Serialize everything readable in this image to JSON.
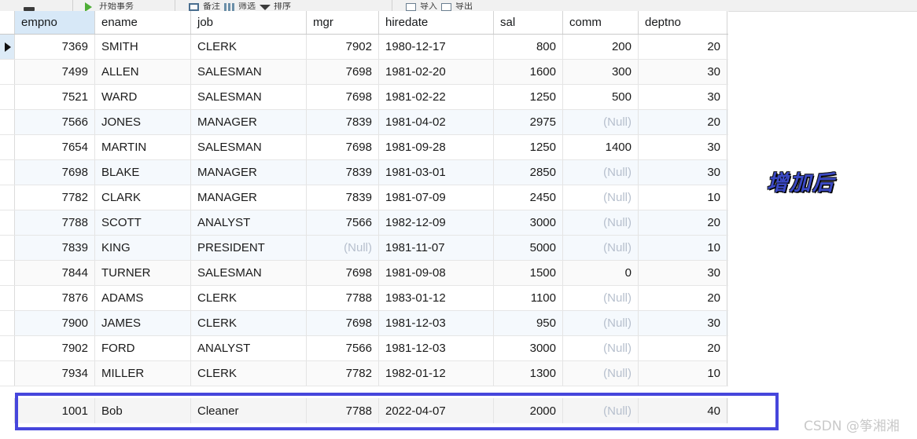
{
  "toolbar": {
    "groups": [
      {
        "items": [
          {
            "icon": "save-icon",
            "label": ""
          }
        ]
      },
      {
        "items": [
          {
            "icon": "run-icon",
            "label": "开始事务"
          }
        ]
      },
      {
        "items": [
          {
            "icon": "note-icon",
            "label": "备注"
          },
          {
            "icon": "filter-icon",
            "label": "筛选"
          },
          {
            "icon": "sort-icon",
            "label": "排序"
          }
        ]
      },
      {
        "items": [
          {
            "icon": "import-icon",
            "label": "导入"
          },
          {
            "icon": "export-icon",
            "label": "导出"
          }
        ]
      }
    ]
  },
  "grid": {
    "columns": [
      {
        "key": "empno",
        "label": "empno",
        "align": "num",
        "selected": true
      },
      {
        "key": "ename",
        "label": "ename",
        "align": "txt",
        "selected": false
      },
      {
        "key": "job",
        "label": "job",
        "align": "txt",
        "selected": false
      },
      {
        "key": "mgr",
        "label": "mgr",
        "align": "num",
        "selected": false
      },
      {
        "key": "hiredate",
        "label": "hiredate",
        "align": "txt",
        "selected": false
      },
      {
        "key": "sal",
        "label": "sal",
        "align": "num",
        "selected": false
      },
      {
        "key": "comm",
        "label": "comm",
        "align": "num",
        "selected": false
      },
      {
        "key": "deptno",
        "label": "deptno",
        "align": "num",
        "selected": false
      }
    ],
    "null_text": "(Null)",
    "current_row_index": 0,
    "rows": [
      {
        "empno": "7369",
        "ename": "SMITH",
        "job": "CLERK",
        "mgr": "7902",
        "hiredate": "1980-12-17",
        "sal": "800",
        "comm": "200",
        "deptno": "20"
      },
      {
        "empno": "7499",
        "ename": "ALLEN",
        "job": "SALESMAN",
        "mgr": "7698",
        "hiredate": "1981-02-20",
        "sal": "1600",
        "comm": "300",
        "deptno": "30"
      },
      {
        "empno": "7521",
        "ename": "WARD",
        "job": "SALESMAN",
        "mgr": "7698",
        "hiredate": "1981-02-22",
        "sal": "1250",
        "comm": "500",
        "deptno": "30"
      },
      {
        "empno": "7566",
        "ename": "JONES",
        "job": "MANAGER",
        "mgr": "7839",
        "hiredate": "1981-04-02",
        "sal": "2975",
        "comm": "(Null)",
        "deptno": "20"
      },
      {
        "empno": "7654",
        "ename": "MARTIN",
        "job": "SALESMAN",
        "mgr": "7698",
        "hiredate": "1981-09-28",
        "sal": "1250",
        "comm": "1400",
        "deptno": "30"
      },
      {
        "empno": "7698",
        "ename": "BLAKE",
        "job": "MANAGER",
        "mgr": "7839",
        "hiredate": "1981-03-01",
        "sal": "2850",
        "comm": "(Null)",
        "deptno": "30"
      },
      {
        "empno": "7782",
        "ename": "CLARK",
        "job": "MANAGER",
        "mgr": "7839",
        "hiredate": "1981-07-09",
        "sal": "2450",
        "comm": "(Null)",
        "deptno": "10"
      },
      {
        "empno": "7788",
        "ename": "SCOTT",
        "job": "ANALYST",
        "mgr": "7566",
        "hiredate": "1982-12-09",
        "sal": "3000",
        "comm": "(Null)",
        "deptno": "20"
      },
      {
        "empno": "7839",
        "ename": "KING",
        "job": "PRESIDENT",
        "mgr": "(Null)",
        "hiredate": "1981-11-07",
        "sal": "5000",
        "comm": "(Null)",
        "deptno": "10"
      },
      {
        "empno": "7844",
        "ename": "TURNER",
        "job": "SALESMAN",
        "mgr": "7698",
        "hiredate": "1981-09-08",
        "sal": "1500",
        "comm": "0",
        "deptno": "30"
      },
      {
        "empno": "7876",
        "ename": "ADAMS",
        "job": "CLERK",
        "mgr": "7788",
        "hiredate": "1983-01-12",
        "sal": "1100",
        "comm": "(Null)",
        "deptno": "20"
      },
      {
        "empno": "7900",
        "ename": "JAMES",
        "job": "CLERK",
        "mgr": "7698",
        "hiredate": "1981-12-03",
        "sal": "950",
        "comm": "(Null)",
        "deptno": "30"
      },
      {
        "empno": "7902",
        "ename": "FORD",
        "job": "ANALYST",
        "mgr": "7566",
        "hiredate": "1981-12-03",
        "sal": "3000",
        "comm": "(Null)",
        "deptno": "20"
      },
      {
        "empno": "7934",
        "ename": "MILLER",
        "job": "CLERK",
        "mgr": "7782",
        "hiredate": "1982-01-12",
        "sal": "1300",
        "comm": "(Null)",
        "deptno": "10"
      }
    ],
    "highlighted_row": {
      "empno": "1001",
      "ename": "Bob",
      "job": "Cleaner",
      "mgr": "7788",
      "hiredate": "2022-04-07",
      "sal": "2000",
      "comm": "(Null)",
      "deptno": "40"
    }
  },
  "annotations": {
    "label": "增加后",
    "label_color": "#3b49c4",
    "box_color": "#4646dc"
  },
  "watermark": {
    "text": "CSDN @筝湘湘"
  }
}
